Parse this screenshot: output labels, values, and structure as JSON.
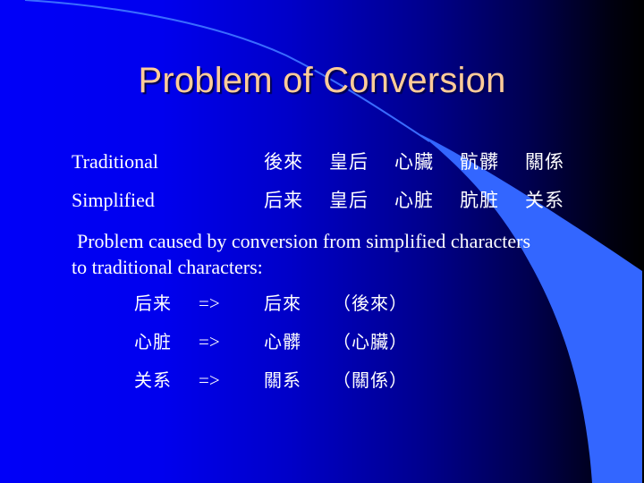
{
  "slide": {
    "title": "Problem of Conversion",
    "colors": {
      "title": "#ffcc99",
      "text": "#ffffff",
      "background_left": "#0000f8",
      "background_right": "#000000",
      "swoosh": "#3366ff"
    },
    "comparison": {
      "traditional": {
        "label": "Traditional",
        "words": [
          "後來",
          "皇后",
          "心臟",
          "骯髒",
          "關係"
        ]
      },
      "simplified": {
        "label": "Simplified",
        "words": [
          "后来",
          "皇后",
          "心脏",
          "肮脏",
          "关系"
        ]
      }
    },
    "paragraph": {
      "line1": "Problem caused by conversion from simplified characters",
      "line2": "to traditional characters:"
    },
    "conversions": [
      {
        "simplified": "后来",
        "arrow": "=>",
        "wrong_result": "后來",
        "correct": "（後來）"
      },
      {
        "simplified": "心脏",
        "arrow": "=>",
        "wrong_result": "心髒",
        "correct": "（心臟）"
      },
      {
        "simplified": "关系",
        "arrow": "=>",
        "wrong_result": "關系",
        "correct": "（關係）"
      }
    ]
  }
}
